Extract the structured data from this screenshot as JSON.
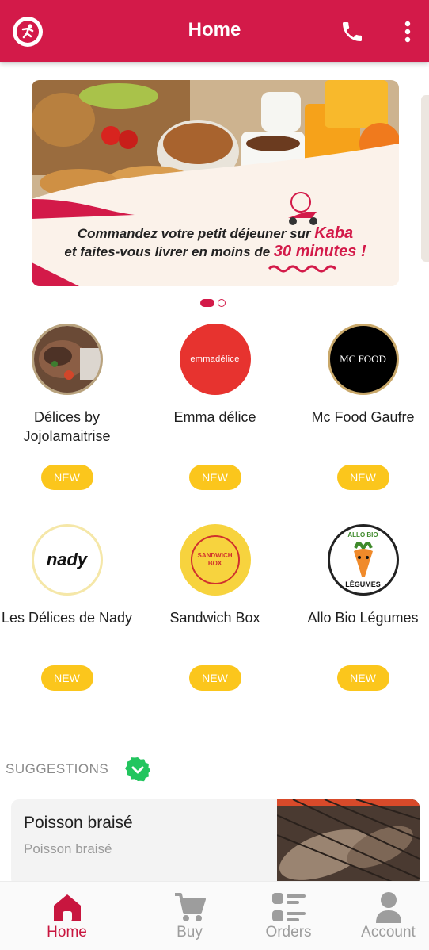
{
  "header": {
    "title": "Home"
  },
  "banner": {
    "line1_prefix": "Commandez votre petit déjeuner sur ",
    "line1_highlight": "Kaba",
    "line2_prefix": "et faites-vous livrer en moins de ",
    "line2_highlight": "30 minutes !",
    "page_count": 2,
    "active_page": 1
  },
  "stores": [
    {
      "name": "Délices by Jojolamaitrise",
      "badge": "NEW"
    },
    {
      "name": "Emma délice",
      "badge": "NEW",
      "logo_text": "emmadélice"
    },
    {
      "name": "Mc Food Gaufre",
      "badge": "NEW",
      "logo_text": "MC FOOD"
    },
    {
      "name": "Les Délices de Nady",
      "badge": "NEW",
      "logo_text": "nady"
    },
    {
      "name": "Sandwich Box",
      "badge": "NEW",
      "logo_text": "SANDWICH BOX"
    },
    {
      "name": "Allo Bio Légumes",
      "badge": "NEW",
      "logo_text_top": "ALLO BIO",
      "logo_text_bottom": "LÉGUMES"
    }
  ],
  "suggestions": {
    "title": "SUGGESTIONS",
    "items": [
      {
        "name": "Poisson braisé",
        "description": "Poisson braisé"
      }
    ]
  },
  "bottom_nav": [
    {
      "label": "Home",
      "icon": "home-icon",
      "active": true
    },
    {
      "label": "Buy",
      "icon": "cart-icon",
      "active": false
    },
    {
      "label": "Orders",
      "icon": "orders-list-icon",
      "active": false
    },
    {
      "label": "Account",
      "icon": "account-icon",
      "active": false
    }
  ],
  "colors": {
    "primary": "#d31a49",
    "badge": "#fbc61c",
    "check": "#22c55e"
  }
}
